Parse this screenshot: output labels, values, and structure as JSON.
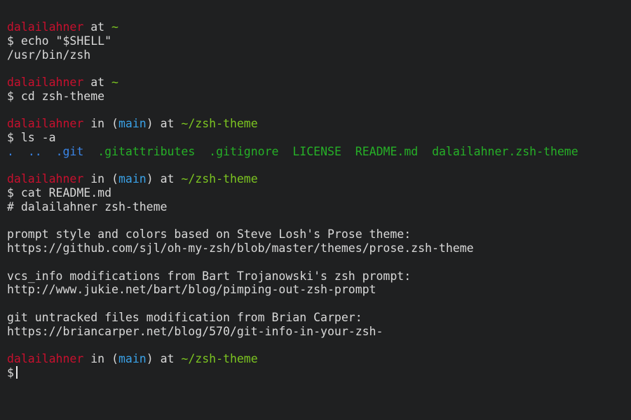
{
  "colors": {
    "background": "#1f2021",
    "text": "#d9d9d9",
    "user": "#c8102e",
    "branch": "#3aa2e8",
    "path": "#7cc521",
    "directory": "#3a86e8",
    "file": "#26b027"
  },
  "prompts": [
    {
      "user": "dalailahner",
      "at": "at",
      "path": "~"
    },
    {
      "user": "dalailahner",
      "at": "at",
      "path": "~"
    },
    {
      "user": "dalailahner",
      "in": "in",
      "paren_open": "(",
      "branch": "main",
      "paren_close": ")",
      "at": "at",
      "path": "~/zsh-theme"
    },
    {
      "user": "dalailahner",
      "in": "in",
      "paren_open": "(",
      "branch": "main",
      "paren_close": ")",
      "at": "at",
      "path": "~/zsh-theme"
    },
    {
      "user": "dalailahner",
      "in": "in",
      "paren_open": "(",
      "branch": "main",
      "paren_close": ")",
      "at": "at",
      "path": "~/zsh-theme"
    }
  ],
  "commands": [
    "$ echo \"$SHELL\"",
    "$ cd zsh-theme",
    "$ ls -a",
    "$ cat README.md",
    "$"
  ],
  "outputs": {
    "shell_path": "/usr/bin/zsh",
    "ls_entries": [
      ".",
      "..",
      ".git",
      ".gitattributes",
      ".gitignore",
      "LICENSE",
      "README.md",
      "dalailahner.zsh-theme"
    ],
    "readme": [
      "# dalailahner zsh-theme",
      "",
      "prompt style and colors based on Steve Losh's Prose theme:",
      "https://github.com/sjl/oh-my-zsh/blob/master/themes/prose.zsh-theme",
      "",
      "vcs_info modifications from Bart Trojanowski's zsh prompt:",
      "http://www.jukie.net/bart/blog/pimping-out-zsh-prompt",
      "",
      "git untracked files modification from Brian Carper:",
      "https://briancarper.net/blog/570/git-info-in-your-zsh-"
    ]
  }
}
